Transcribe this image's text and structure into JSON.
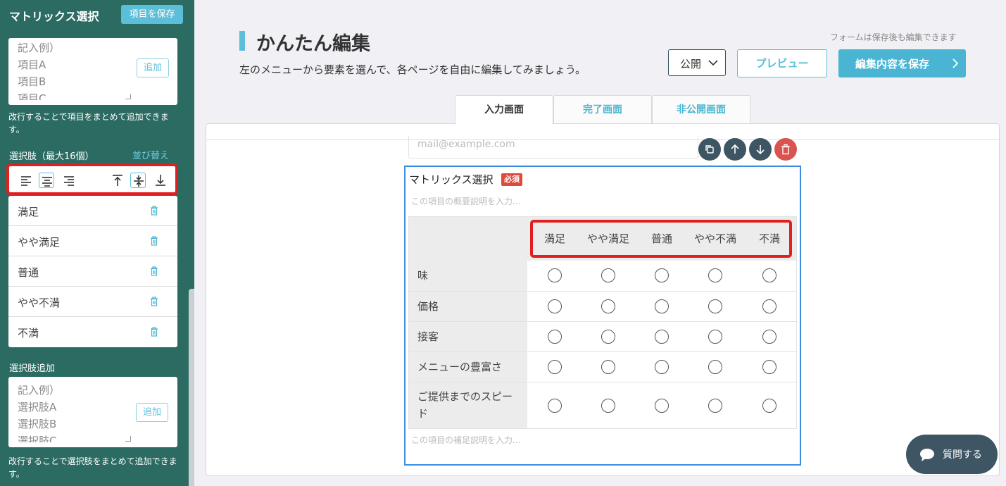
{
  "sidebar": {
    "title": "マトリックス選択",
    "save_label": "項目を保存",
    "items_textarea": {
      "lines": [
        "記入例）",
        "項目A",
        "項目B",
        "項目C"
      ],
      "add_label": "追加"
    },
    "items_help": "改行することで項目をまとめて追加できます。",
    "choices_label": "選択肢（最大16個）",
    "sort_label": "並び替え",
    "align_buttons": [
      "align-left",
      "align-center",
      "align-right",
      "align-top",
      "align-middle",
      "align-bottom"
    ],
    "choices": [
      "満足",
      "やや満足",
      "普通",
      "やや不満",
      "不満"
    ],
    "add_choices_label": "選択肢追加",
    "choices_textarea": {
      "lines": [
        "記入例）",
        "選択肢A",
        "選択肢B",
        "選択肢C"
      ],
      "add_label": "追加"
    },
    "choices_help": "改行することで選択肢をまとめて追加できます。"
  },
  "header": {
    "title": "かんたん編集",
    "subtitle": "左のメニューから要素を選んで、各ページを自由に編集してみましょう。",
    "note": "フォームは保存後も編集できます",
    "publish_select": "公開",
    "preview_label": "プレビュー",
    "save_content_label": "編集内容を保存"
  },
  "tabs": [
    {
      "label": "入力画面",
      "active": true
    },
    {
      "label": "完了画面",
      "active": false
    },
    {
      "label": "非公開画面",
      "active": false
    }
  ],
  "canvas": {
    "email_placeholder": "mail@example.com",
    "controls": [
      "copy-icon",
      "arrow-up-icon",
      "arrow-down-icon",
      "trash-icon"
    ],
    "matrix": {
      "title": "マトリックス選択",
      "required_badge": "必須",
      "description_placeholder": "この項目の概要説明を入力...",
      "footnote_placeholder": "この項目の補足説明を入力...",
      "columns": [
        "満足",
        "やや満足",
        "普通",
        "やや不満",
        "不満"
      ],
      "rows": [
        "味",
        "価格",
        "接客",
        "メニューの豊富さ",
        "ご提供までのスピード"
      ]
    }
  },
  "chat": {
    "label": "質問する"
  },
  "colors": {
    "sidebar": "#2b6b61",
    "accent": "#5bbfd9",
    "highlight": "#e02020",
    "required": "#e04a3a"
  }
}
